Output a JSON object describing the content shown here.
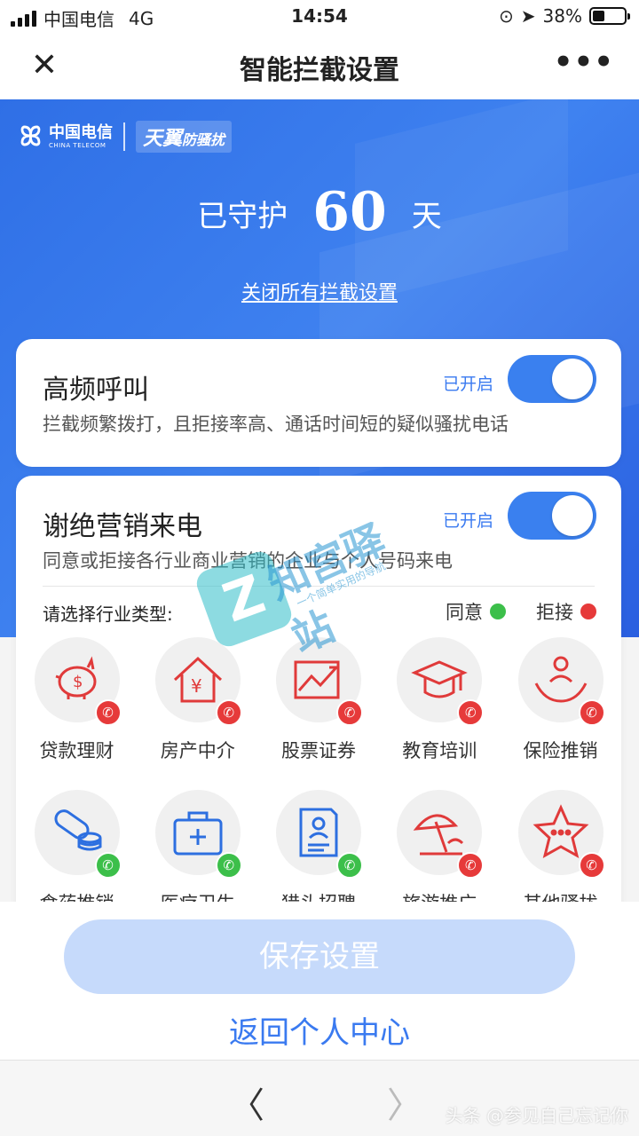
{
  "status_bar": {
    "carrier": "中国电信",
    "network": "4G",
    "time": "14:54",
    "battery_text": "38%",
    "battery_level": 0.38
  },
  "nav": {
    "title": "智能拦截设置",
    "close_icon": "close-icon",
    "more_icon": "more-icon"
  },
  "hero": {
    "brand_cn": "中国电信",
    "brand_en": "CHINA TELECOM",
    "product_a": "天翼",
    "product_b": "防骚扰",
    "guard_prefix": "已守护",
    "guard_days": "60",
    "guard_suffix": "天",
    "close_all_link": "关闭所有拦截设置",
    "color": "#3579ea"
  },
  "cards": {
    "high_freq": {
      "title": "高频呼叫",
      "state": "已开启",
      "enabled": true,
      "desc": "拦截频繁拨打，且拒接率高、通话时间短的疑似骚扰电话"
    },
    "marketing": {
      "title": "谢绝营销来电",
      "state": "已开启",
      "enabled": true,
      "desc": "同意或拒接各行业商业营销的企业与个人号码来电",
      "industry_title": "请选择行业类型:",
      "legend_agree": "同意",
      "legend_reject": "拒接",
      "agree_color": "#3cbf4a",
      "reject_color": "#e63a3a",
      "industries": [
        {
          "label": "贷款理财",
          "icon": "piggy-bank-icon",
          "status": "reject"
        },
        {
          "label": "房产中介",
          "icon": "house-yen-icon",
          "status": "reject"
        },
        {
          "label": "股票证券",
          "icon": "stock-chart-icon",
          "status": "reject"
        },
        {
          "label": "教育培训",
          "icon": "graduation-cap-icon",
          "status": "reject"
        },
        {
          "label": "保险推销",
          "icon": "insurance-hands-icon",
          "status": "reject"
        },
        {
          "label": "食药推销",
          "icon": "pill-coins-icon",
          "status": "agree"
        },
        {
          "label": "医疗卫生",
          "icon": "medical-kit-icon",
          "status": "agree"
        },
        {
          "label": "猎头招聘",
          "icon": "resume-icon",
          "status": "agree"
        },
        {
          "label": "旅游推广",
          "icon": "beach-umbrella-icon",
          "status": "reject"
        },
        {
          "label": "其他骚扰",
          "icon": "star-chat-icon",
          "status": "reject"
        }
      ]
    }
  },
  "actions": {
    "save": "保存设置",
    "back": "返回个人中心"
  },
  "browser": {
    "back_icon": "chevron-left-icon",
    "forward_icon": "chevron-right-icon",
    "credit": "头条 @参见自己忘记你"
  },
  "watermark": {
    "title": "知宫驿站",
    "subtitle": "一个简单实用的导航"
  }
}
